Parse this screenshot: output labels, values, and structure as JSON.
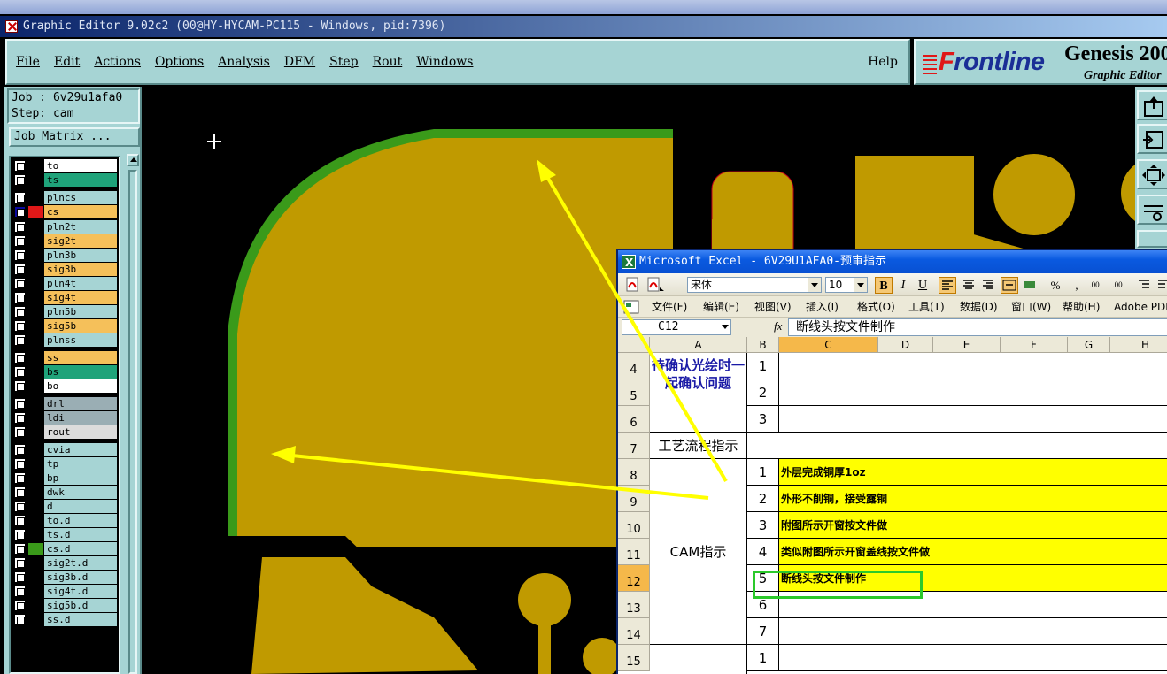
{
  "genesis": {
    "title": "Graphic Editor 9.02c2 (00@HY-HYCAM-PC115 - Windows, pid:7396)",
    "menu": [
      "File",
      "Edit",
      "Actions",
      "Options",
      "Analysis",
      "DFM",
      "Step",
      "Rout",
      "Windows"
    ],
    "help": "Help",
    "brand": {
      "logo_first": "F",
      "logo_rest": "rontline",
      "product": "Genesis 200",
      "subtitle": "Graphic Editor"
    },
    "job_label": "Job : 6v29u1afa0",
    "step_label": "Step: cam",
    "job_matrix": "Job Matrix ...",
    "layers": [
      {
        "name": "to",
        "bg": "#ffffff",
        "swatch": "#000000"
      },
      {
        "name": "ts",
        "bg": "#1fa37a",
        "swatch": "#000000"
      },
      {
        "name": "plncs",
        "bg": "#a6d4d4",
        "swatch": "#000000"
      },
      {
        "name": "cs",
        "bg": "#f5c05a",
        "swatch": "#e01818",
        "active": true
      },
      {
        "name": "pln2t",
        "bg": "#a6d4d4",
        "swatch": "#000000"
      },
      {
        "name": "sig2t",
        "bg": "#f5c05a",
        "swatch": "#000000"
      },
      {
        "name": "pln3b",
        "bg": "#a6d4d4",
        "swatch": "#000000"
      },
      {
        "name": "sig3b",
        "bg": "#f5c05a",
        "swatch": "#000000"
      },
      {
        "name": "pln4t",
        "bg": "#a6d4d4",
        "swatch": "#000000"
      },
      {
        "name": "sig4t",
        "bg": "#f5c05a",
        "swatch": "#000000"
      },
      {
        "name": "pln5b",
        "bg": "#a6d4d4",
        "swatch": "#000000"
      },
      {
        "name": "sig5b",
        "bg": "#f5c05a",
        "swatch": "#000000"
      },
      {
        "name": "plnss",
        "bg": "#a6d4d4",
        "swatch": "#000000"
      },
      {
        "name": "ss",
        "bg": "#f5c05a",
        "swatch": "#000000"
      },
      {
        "name": "bs",
        "bg": "#1fa37a",
        "swatch": "#000000"
      },
      {
        "name": "bo",
        "bg": "#ffffff",
        "swatch": "#000000"
      },
      {
        "name": "drl",
        "bg": "#9aaeb4",
        "swatch": "#000000"
      },
      {
        "name": "ldi",
        "bg": "#9aaeb4",
        "swatch": "#000000"
      },
      {
        "name": "rout",
        "bg": "#dcdcdc",
        "swatch": "#000000"
      },
      {
        "name": "cvia",
        "bg": "#a6d4d4",
        "swatch": "#000000"
      },
      {
        "name": "tp",
        "bg": "#a6d4d4",
        "swatch": "#000000"
      },
      {
        "name": "bp",
        "bg": "#a6d4d4",
        "swatch": "#000000"
      },
      {
        "name": "dwk",
        "bg": "#a6d4d4",
        "swatch": "#000000"
      },
      {
        "name": "d",
        "bg": "#a6d4d4",
        "swatch": "#000000"
      },
      {
        "name": "to.d",
        "bg": "#a6d4d4",
        "swatch": "#000000"
      },
      {
        "name": "ts.d",
        "bg": "#a6d4d4",
        "swatch": "#000000"
      },
      {
        "name": "cs.d",
        "bg": "#a6d4d4",
        "swatch": "#3a9a1a"
      },
      {
        "name": "sig2t.d",
        "bg": "#a6d4d4",
        "swatch": "#000000"
      },
      {
        "name": "sig3b.d",
        "bg": "#a6d4d4",
        "swatch": "#000000"
      },
      {
        "name": "sig4t.d",
        "bg": "#a6d4d4",
        "swatch": "#000000"
      },
      {
        "name": "sig5b.d",
        "bg": "#a6d4d4",
        "swatch": "#000000"
      },
      {
        "name": "ss.d",
        "bg": "#a6d4d4",
        "swatch": "#000000"
      }
    ],
    "colors": {
      "copper": "#c09a00",
      "outline": "#3a9a1a",
      "panel": "#a6d4d4"
    }
  },
  "excel": {
    "title": "Microsoft Excel - 6V29U1AFA0-预审指示",
    "font_name": "宋体",
    "font_size": "10",
    "menu": [
      "文件(F)",
      "编辑(E)",
      "视图(V)",
      "插入(I)",
      "格式(O)",
      "工具(T)",
      "数据(D)",
      "窗口(W)",
      "帮助(H)",
      "Adobe PDF(B)"
    ],
    "name_box": "C12",
    "fx": "fx",
    "formula": "断线头按文件制作",
    "columns": [
      "A",
      "B",
      "C",
      "D",
      "E",
      "F",
      "G",
      "H"
    ],
    "rows": [
      "4",
      "5",
      "6",
      "7",
      "8",
      "9",
      "10",
      "11",
      "12",
      "13",
      "14",
      "15"
    ],
    "group1_label": "待确认光绘时一起确认问题",
    "group1_nums": [
      "1",
      "2",
      "3"
    ],
    "process_label": "工艺流程指示",
    "cam_label": "CAM指示",
    "cam_nums": [
      "1",
      "2",
      "3",
      "4",
      "5",
      "6",
      "7"
    ],
    "cam_items": [
      "外层完成铜厚1oz",
      "外形不削铜，接受露铜",
      "附图所示开窗按文件做",
      "类似附图所示开窗盖线按文件做",
      "断线头按文件制作",
      "",
      ""
    ],
    "last_num": "1"
  }
}
